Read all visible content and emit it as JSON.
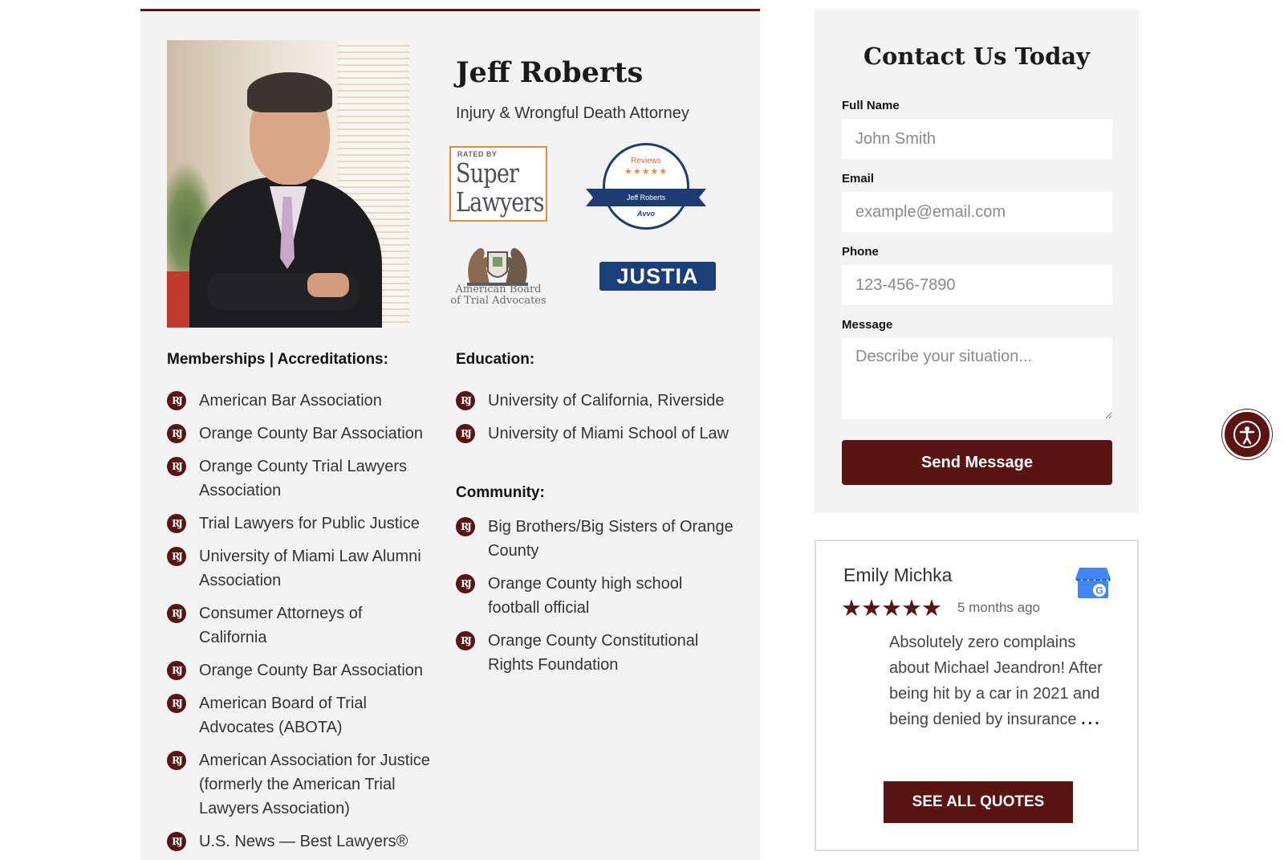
{
  "attorney": {
    "name": "Jeff Roberts",
    "title": "Injury & Wrongful Death Attorney"
  },
  "badges": {
    "super_lawyers": {
      "rated_by": "RATED BY",
      "line1": "Super",
      "line2": "Lawyers"
    },
    "avvo": {
      "reviews": "Reviews",
      "stars": "★★★★★",
      "name": "Jeff Roberts",
      "brand": "Avvo"
    },
    "abota": {
      "line1": "American Board",
      "line2": "of Trial Advocates"
    },
    "justia": "JUSTIA"
  },
  "bullet_icon": "RJ",
  "memberships": {
    "heading": "Memberships | Accreditations:",
    "items": [
      "American Bar Association",
      "Orange County Bar Association",
      "Orange County Trial Lawyers Association",
      "Trial Lawyers for Public Justice",
      "University of Miami Law Alumni Association",
      "Consumer Attorneys of California",
      "Orange County Bar Association",
      "American Board of Trial Advocates (ABOTA)",
      "American Association for Justice (formerly the American Trial Lawyers Association)",
      "U.S. News — Best Lawyers®"
    ]
  },
  "education": {
    "heading": "Education:",
    "items": [
      "University of California, Riverside",
      "University of Miami School of Law"
    ]
  },
  "community": {
    "heading": "Community:",
    "items": [
      "Big Brothers/Big Sisters of Orange County",
      "Orange County high school football official",
      "Orange County Constitutional Rights Foundation"
    ]
  },
  "contact": {
    "title": "Contact Us Today",
    "full_name": {
      "label": "Full Name",
      "placeholder": "John Smith"
    },
    "email": {
      "label": "Email",
      "placeholder": "example@email.com"
    },
    "phone": {
      "label": "Phone",
      "placeholder": "123-456-7890"
    },
    "message": {
      "label": "Message",
      "placeholder": "Describe your situation..."
    },
    "submit_label": "Send Message"
  },
  "review": {
    "reviewer": "Emily Michka",
    "stars": "★★★★★",
    "rating": 5,
    "date": "5 months ago",
    "text": "Absolutely zero complains about Michael Jeandron! After being hit by a car in 2021 and being denied by insurance",
    "more": "...",
    "button_label": "SEE ALL QUOTES"
  },
  "colors": {
    "accent": "#5a1412",
    "panel": "#f3f3f3",
    "justia_blue": "#1c3f7a",
    "super_lawyers_orange": "#f08a3a"
  }
}
